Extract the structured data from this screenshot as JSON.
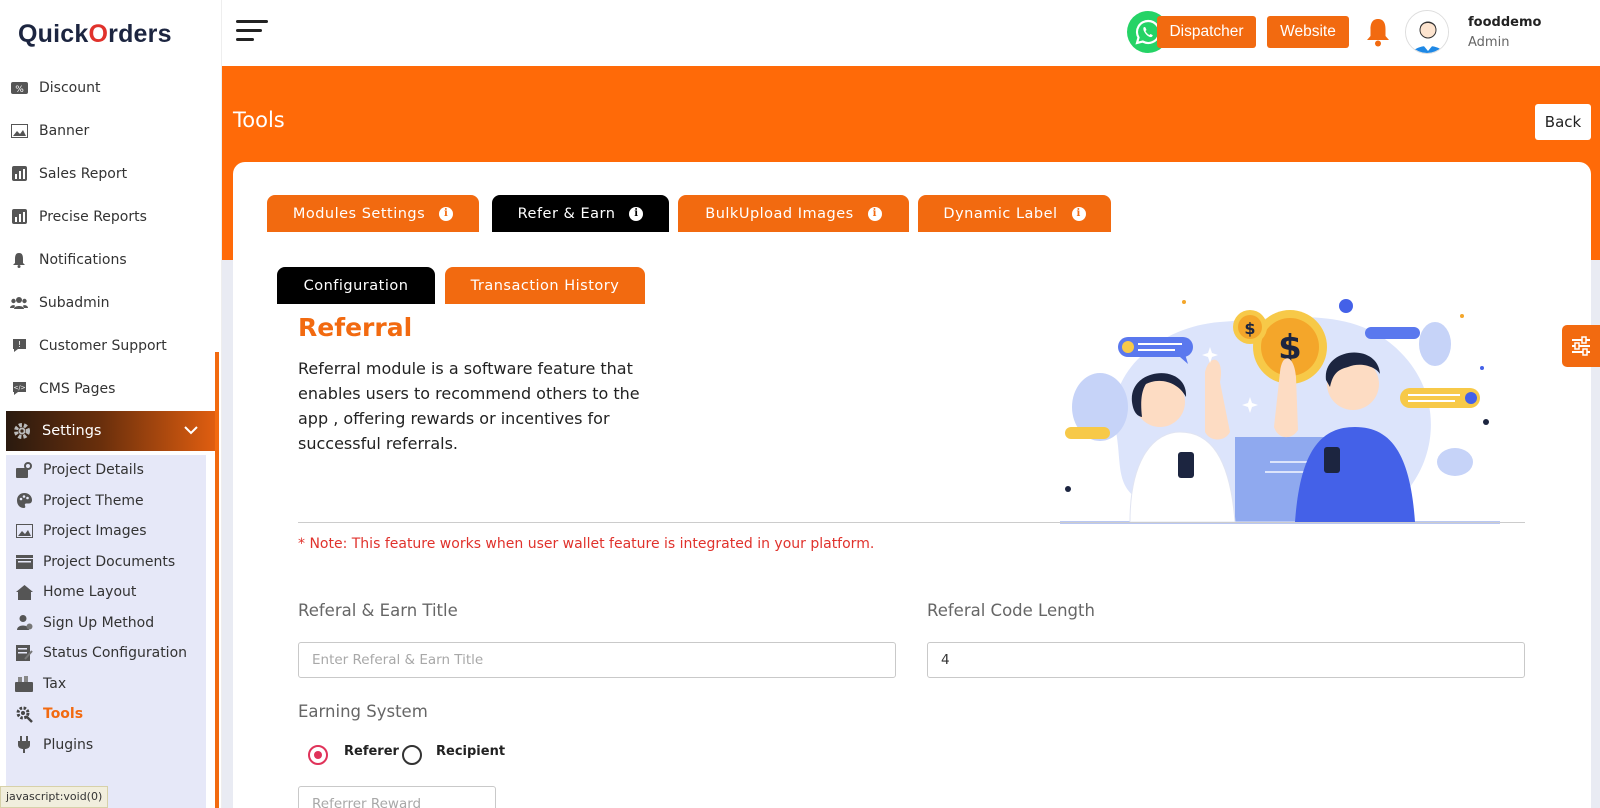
{
  "brand": {
    "name_pre": "Quick",
    "name_o": "O",
    "name_post": "rders"
  },
  "sidebar": {
    "items": [
      {
        "label": "Discount",
        "icon": "discount-icon"
      },
      {
        "label": "Banner",
        "icon": "image-icon"
      },
      {
        "label": "Sales Report",
        "icon": "report-icon"
      },
      {
        "label": "Precise Reports",
        "icon": "report-icon"
      },
      {
        "label": "Notifications",
        "icon": "bell-icon"
      },
      {
        "label": "Subadmin",
        "icon": "users-icon"
      },
      {
        "label": "Customer Support",
        "icon": "support-icon"
      },
      {
        "label": "CMS Pages",
        "icon": "cms-icon"
      }
    ],
    "settings": {
      "label": "Settings",
      "icon": "gear-icon",
      "expanded": true
    },
    "sub_items": [
      {
        "label": "Project Details",
        "icon": "project-details-icon"
      },
      {
        "label": "Project Theme",
        "icon": "palette-icon"
      },
      {
        "label": "Project Images",
        "icon": "image-icon"
      },
      {
        "label": "Project Documents",
        "icon": "documents-icon"
      },
      {
        "label": "Home Layout",
        "icon": "home-icon"
      },
      {
        "label": "Sign Up Method",
        "icon": "signup-icon"
      },
      {
        "label": "Status Configuration",
        "icon": "status-icon"
      },
      {
        "label": "Tax",
        "icon": "tax-icon"
      },
      {
        "label": "Tools",
        "icon": "tools-icon",
        "active": true
      },
      {
        "label": "Plugins",
        "icon": "plug-icon"
      }
    ]
  },
  "status_tip": "javascript:void(0)",
  "header": {
    "dispatcher_label": "Dispatcher",
    "website_label": "Website",
    "user_name": "fooddemo",
    "user_role": "Admin"
  },
  "page": {
    "title": "Tools",
    "back_label": "Back"
  },
  "tabs": [
    {
      "label": "Modules Settings",
      "active": false
    },
    {
      "label": "Refer & Earn",
      "active": true
    },
    {
      "label": "BulkUpload Images",
      "active": false
    },
    {
      "label": "Dynamic Label",
      "active": false
    }
  ],
  "subtabs": [
    {
      "label": "Configuration",
      "active": true
    },
    {
      "label": "Transaction History",
      "active": false
    }
  ],
  "referral": {
    "title": "Referral",
    "description": "Referral module is a software feature that enables users to recommend others to the app , offering rewards or incentives for successful referrals.",
    "note": "* Note: This feature works when user wallet feature is integrated in your platform."
  },
  "form": {
    "title_label": "Referal & Earn Title",
    "title_placeholder": "Enter Referal & Earn Title",
    "title_value": "",
    "code_length_label": "Referal Code Length",
    "code_length_value": "4",
    "earning_label": "Earning System",
    "options": [
      {
        "label": "Referer",
        "selected": true
      },
      {
        "label": "Recipient",
        "selected": false
      }
    ],
    "reward_placeholder": "Referrer Reward"
  },
  "colors": {
    "accent": "#f26a10",
    "band": "#ff6a08",
    "note": "#e0322c",
    "radio": "#e0335a"
  }
}
